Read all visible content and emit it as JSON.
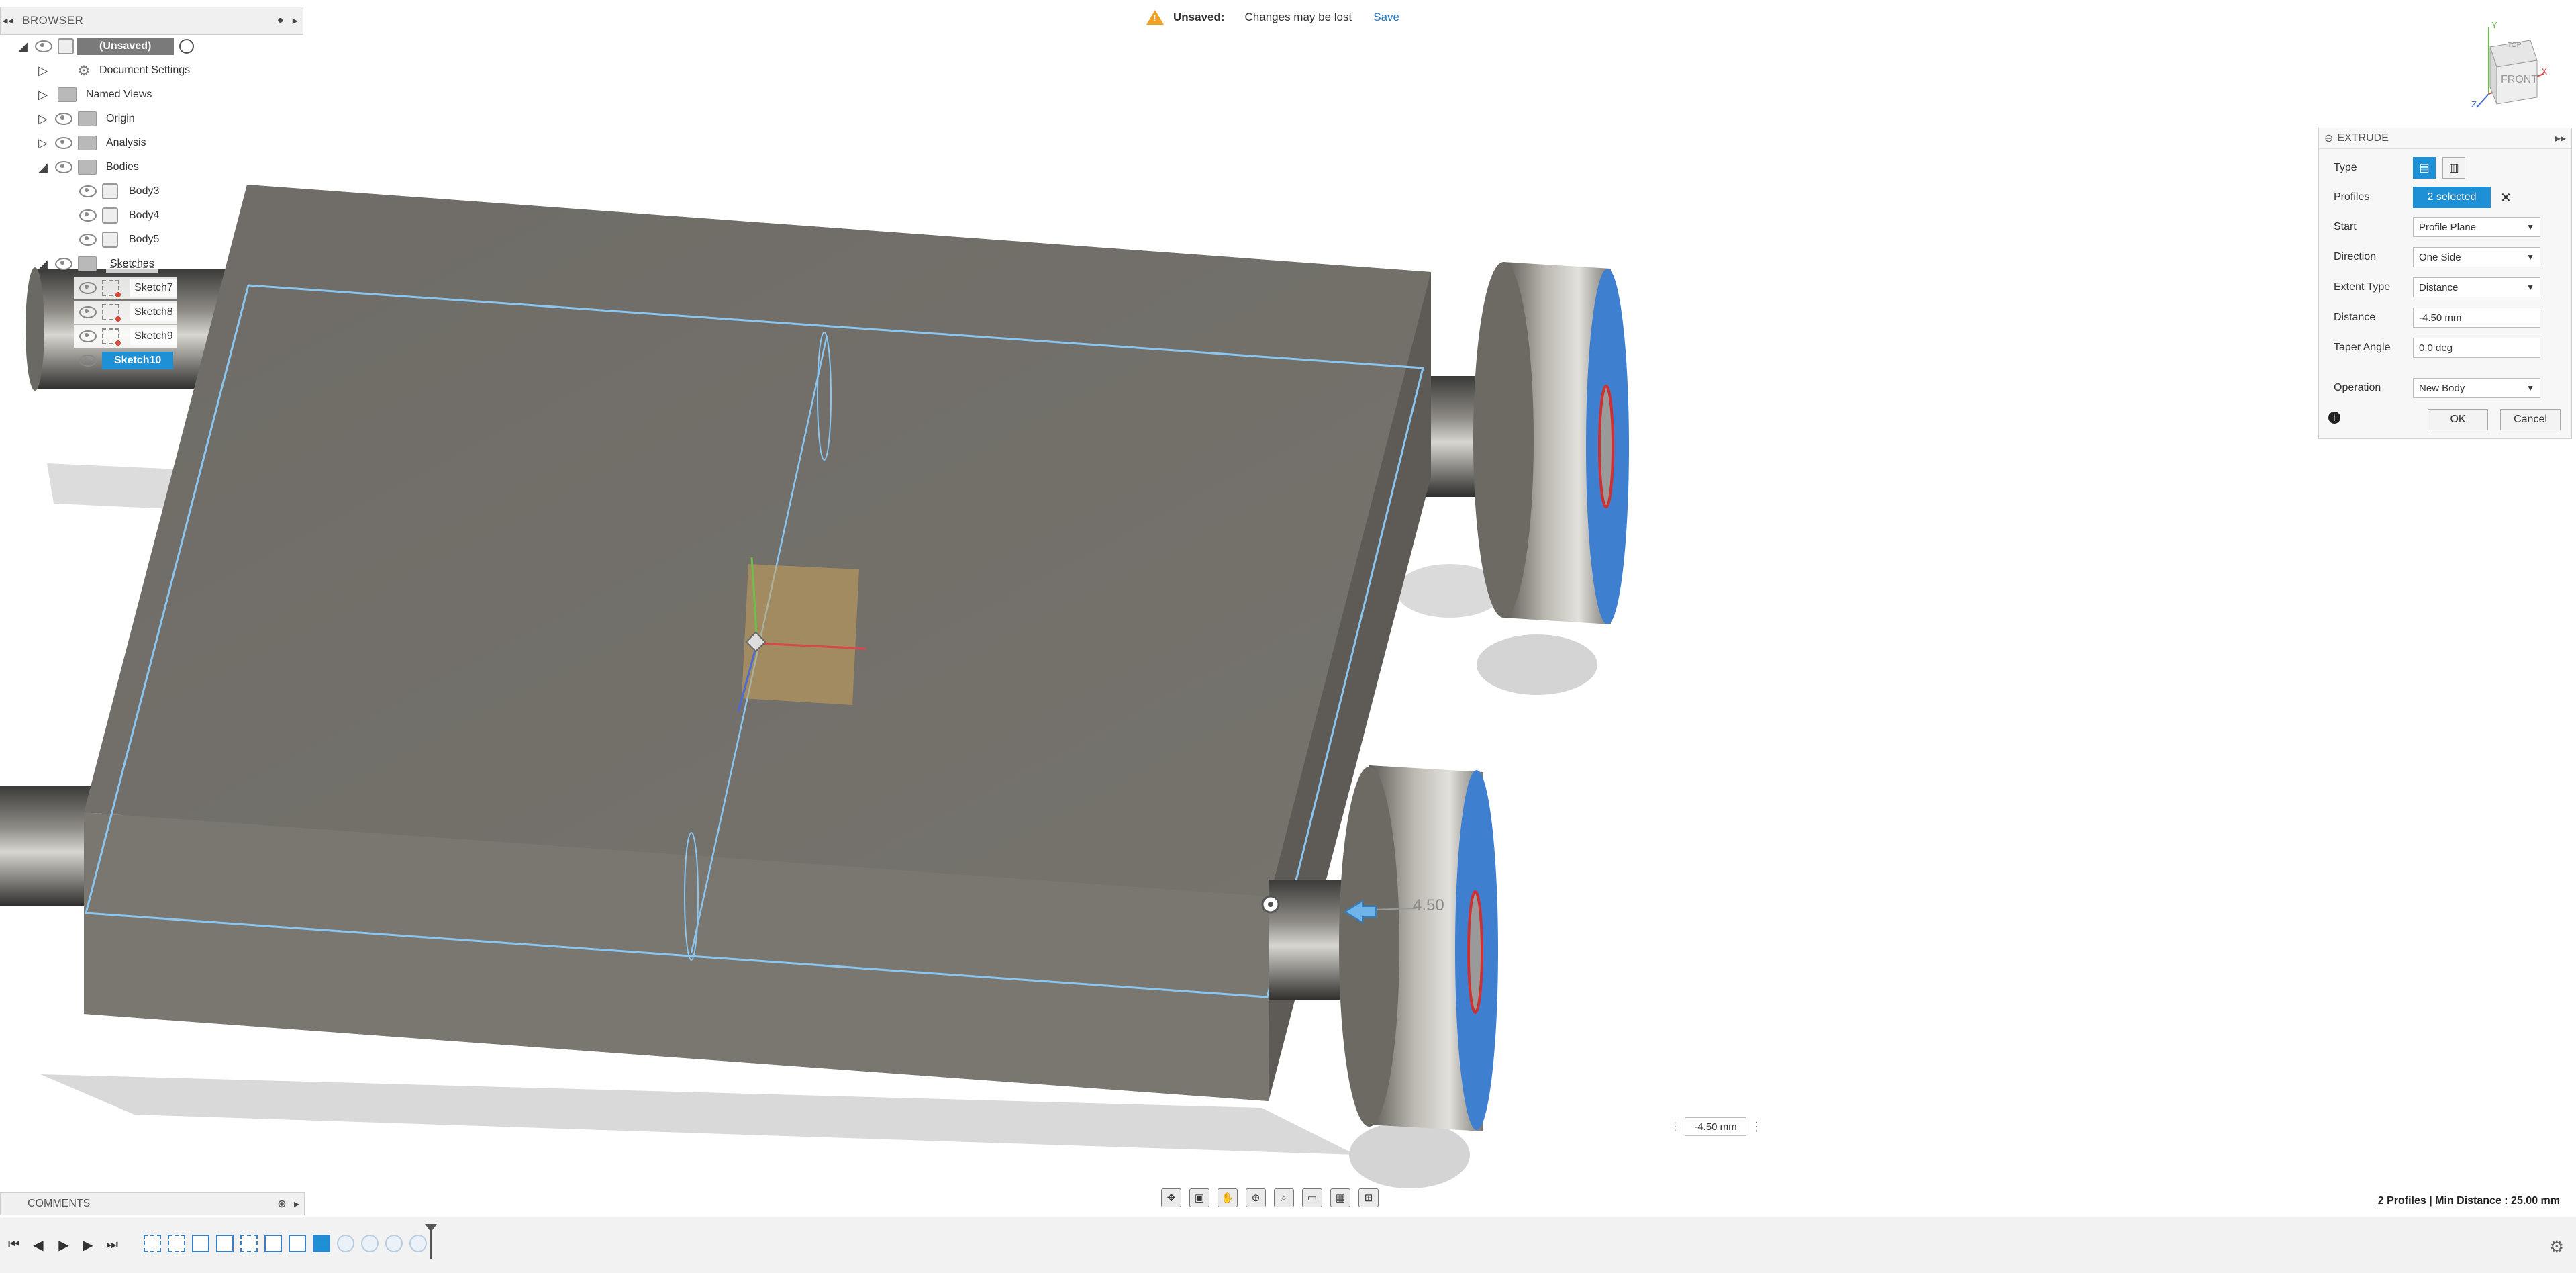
{
  "browser": {
    "title": "BROWSER",
    "document": "(Unsaved)",
    "items": [
      {
        "label": "Document Settings"
      },
      {
        "label": "Named Views"
      },
      {
        "label": "Origin"
      },
      {
        "label": "Analysis"
      },
      {
        "label": "Bodies"
      },
      {
        "label": "Body3"
      },
      {
        "label": "Body4"
      },
      {
        "label": "Body5"
      },
      {
        "label": "Sketches"
      },
      {
        "label": "Sketch7"
      },
      {
        "label": "Sketch8"
      },
      {
        "label": "Sketch9"
      },
      {
        "label": "Sketch10"
      }
    ]
  },
  "notice": {
    "title": "Unsaved:",
    "message": "Changes may be lost",
    "save_label": "Save"
  },
  "viewcube": {
    "face": "FRONT",
    "top": "TOP",
    "x": "X",
    "y": "Y",
    "z": "Z"
  },
  "extrude": {
    "title": "EXTRUDE",
    "rows": {
      "type": "Type",
      "profiles": "Profiles",
      "profiles_value": "2 selected",
      "start": "Start",
      "start_value": "Profile Plane",
      "direction": "Direction",
      "direction_value": "One Side",
      "extent": "Extent Type",
      "extent_value": "Distance",
      "distance": "Distance",
      "distance_value": "-4.50 mm",
      "taper": "Taper Angle",
      "taper_value": "0.0 deg",
      "operation": "Operation",
      "operation_value": "New Body"
    },
    "ok_label": "OK",
    "cancel_label": "Cancel"
  },
  "dimension_label": "4.50",
  "value_input": "-4.50 mm",
  "comments": {
    "title": "COMMENTS"
  },
  "status": "2 Profiles | Min Distance : 25.00 mm",
  "colors": {
    "accent": "#1e90d6",
    "warning": "#f0a020",
    "wheel_face": "#3f7fd0",
    "box": "#6e6b66"
  },
  "icons": [
    "collapse-icon",
    "pin-icon",
    "eye-icon",
    "folder-icon",
    "gear-icon",
    "warning-icon",
    "info-icon",
    "close-icon",
    "play-icon"
  ]
}
